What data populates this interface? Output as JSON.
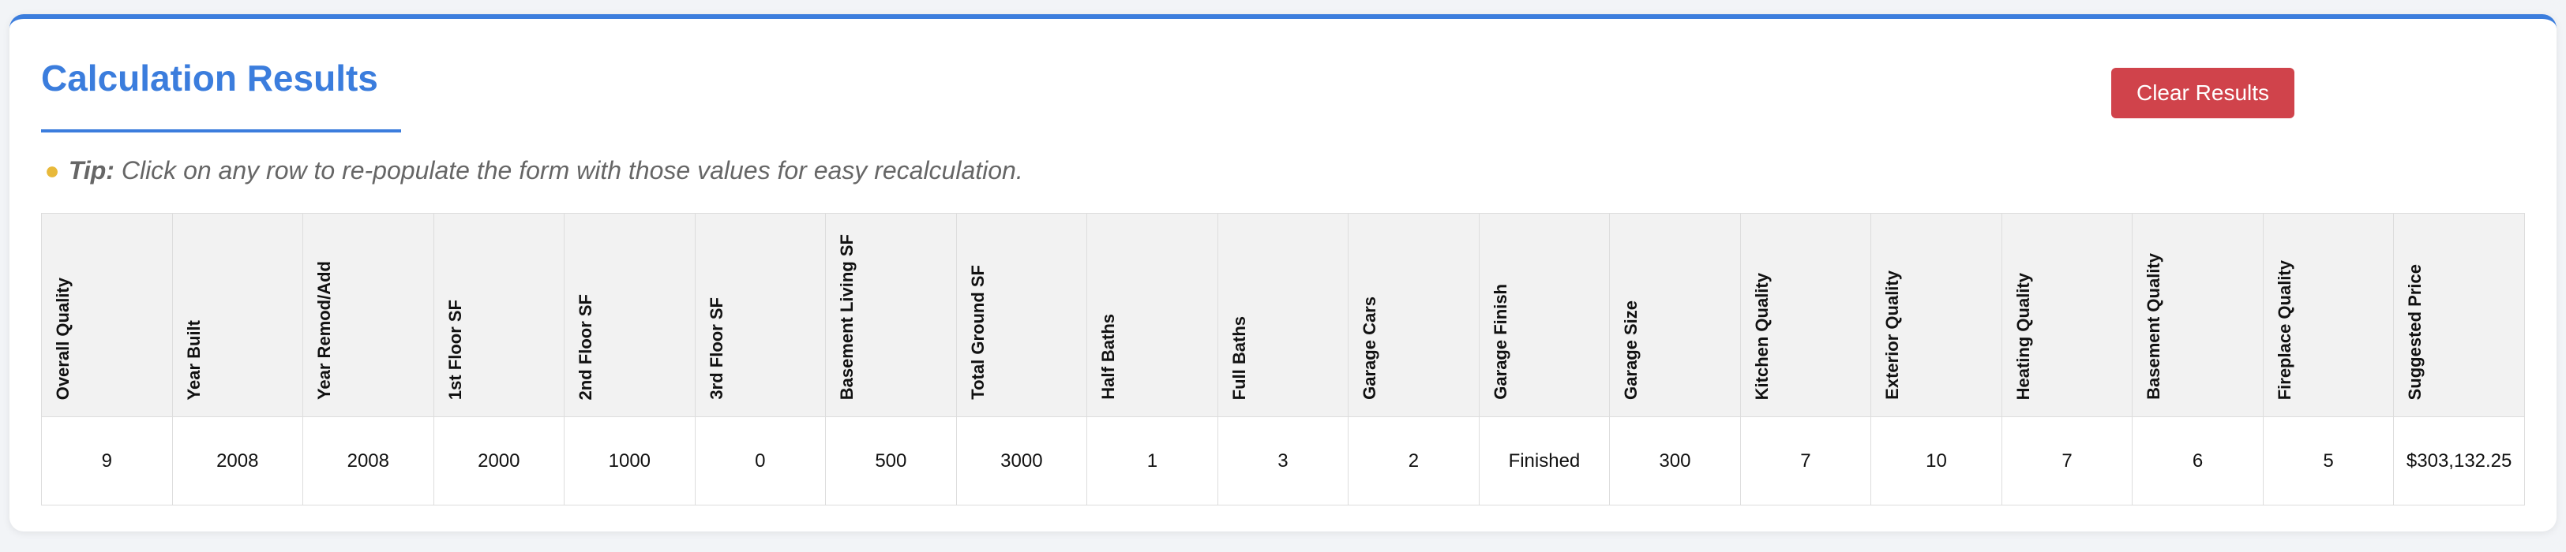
{
  "panel": {
    "title": "Calculation Results",
    "clear_button_label": "Clear Results"
  },
  "tip": {
    "icon": "lightbulb-icon",
    "label": "Tip:",
    "text": " Click on any row to re-populate the form with those values for easy recalculation."
  },
  "table": {
    "columns": [
      "Overall Quality",
      "Year Built",
      "Year Remod/Add",
      "1st Floor SF",
      "2nd Floor SF",
      "3rd Floor SF",
      "Basement Living SF",
      "Total Ground SF",
      "Half Baths",
      "Full Baths",
      "Garage Cars",
      "Garage Finish",
      "Garage Size",
      "Kitchen Quality",
      "Exterior Quality",
      "Heating Quality",
      "Basement Quality",
      "Fireplace Quality",
      "Suggested Price"
    ],
    "rows": [
      [
        "9",
        "2008",
        "2008",
        "2000",
        "1000",
        "0",
        "500",
        "3000",
        "1",
        "3",
        "2",
        "Finished",
        "300",
        "7",
        "10",
        "7",
        "6",
        "5",
        "$303,132.25"
      ]
    ]
  },
  "colors": {
    "accent": "#3b7ddd",
    "danger": "#d0434b"
  }
}
